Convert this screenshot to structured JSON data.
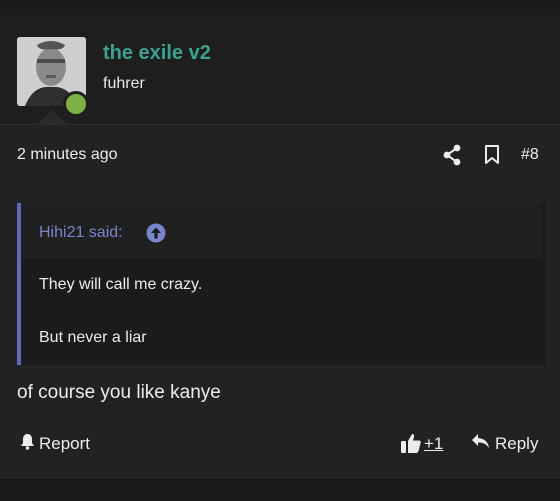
{
  "user": {
    "name": "the exile v2",
    "title": "fuhrer",
    "status_color": "#7cb342",
    "name_color": "#3aa390"
  },
  "meta": {
    "time": "2 minutes ago",
    "post_number": "#8"
  },
  "quote": {
    "author": "Hihi21 said:",
    "lines": [
      "They will call me crazy.",
      "But never a liar"
    ],
    "accent": "#5c6bc0"
  },
  "post": {
    "text": "of course you like kanye"
  },
  "actions": {
    "report": "Report",
    "likes": "+1",
    "reply": "Reply"
  }
}
